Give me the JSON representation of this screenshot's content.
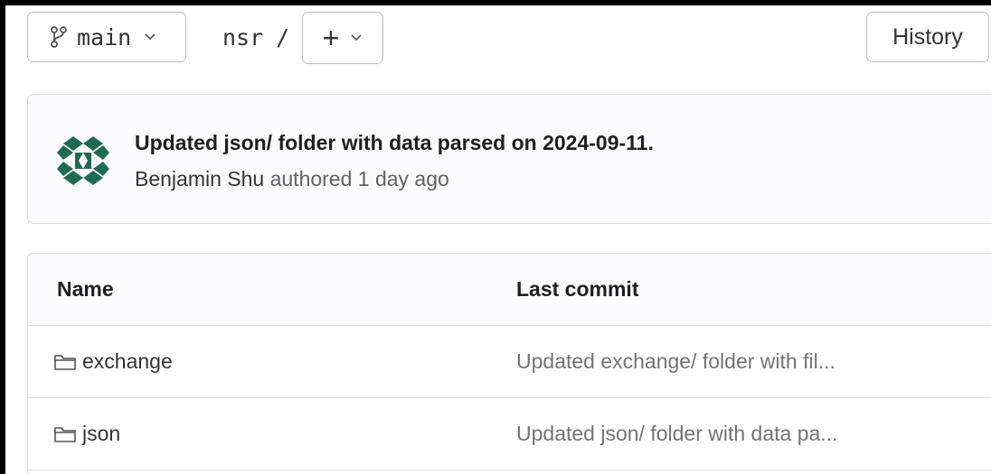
{
  "toolbar": {
    "branch": "main",
    "path_segment": "nsr",
    "path_separator": "/",
    "add_label": "+",
    "history_label": "History"
  },
  "commit": {
    "title": "Updated json/ folder with data parsed on 2024-09-11.",
    "author": "Benjamin Shu",
    "authored_text": "authored 1 day ago"
  },
  "table": {
    "headers": {
      "name": "Name",
      "last_commit": "Last commit"
    },
    "rows": [
      {
        "name": "exchange",
        "message": "Updated exchange/ folder with fil..."
      },
      {
        "name": "json",
        "message": "Updated json/ folder with data pa..."
      }
    ]
  },
  "icons": {
    "branch": "branch-icon",
    "chevron": "chevron-down-icon",
    "folder": "folder-icon",
    "avatar": "identicon"
  },
  "colors": {
    "avatar_primary": "#1f6b52",
    "text_primary": "#1f1e24",
    "text_secondary": "#737278",
    "border": "#dcdcde"
  }
}
